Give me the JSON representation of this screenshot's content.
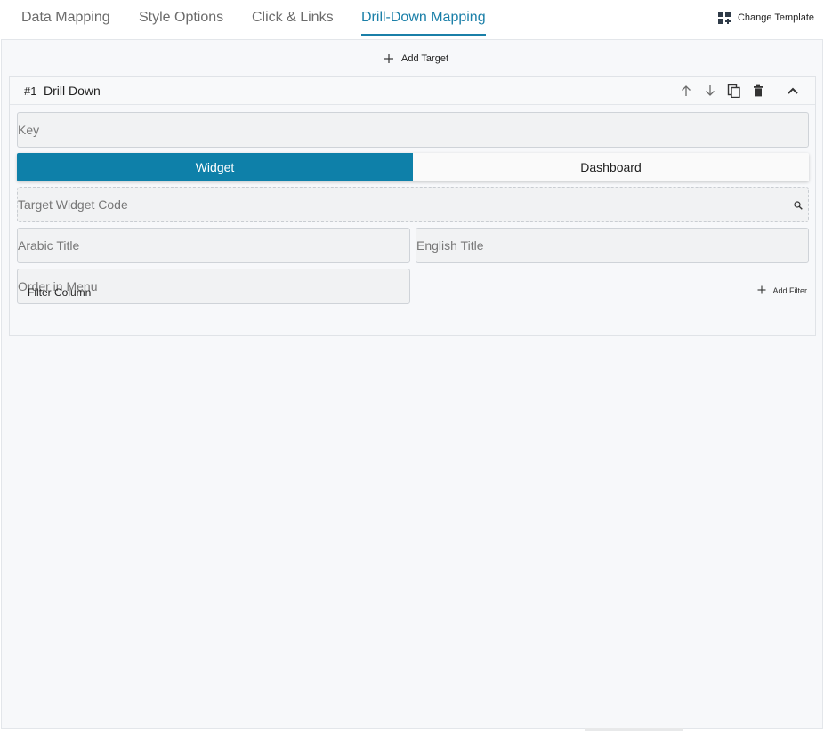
{
  "tabs": [
    {
      "label": "Data Mapping",
      "active": false
    },
    {
      "label": "Style Options",
      "active": false
    },
    {
      "label": "Click & Links",
      "active": false
    },
    {
      "label": "Drill-Down Mapping",
      "active": true
    }
  ],
  "toolbar": {
    "change_template_label": "Change Template",
    "change_template_icon": "dashboard-add-icon"
  },
  "panel": {
    "add_target_label": "Add Target",
    "add_target_icon": "plus-icon"
  },
  "card": {
    "number": "#1",
    "title": "Drill Down",
    "header_icons": [
      "arrow-up-icon",
      "arrow-down-icon",
      "copy-icon",
      "trash-icon",
      "chevron-up-icon"
    ],
    "key_placeholder": "Key",
    "toggle": {
      "options": [
        "Widget",
        "Dashboard"
      ],
      "selected": "Widget"
    },
    "target_widget_placeholder": "Target Widget Code",
    "arabic_title_placeholder": "Arabic Title",
    "english_title_placeholder": "English Title",
    "order_placeholder": "Order in Menu",
    "filter_column_label": "Filter Column",
    "add_filter_label": "Add Filter"
  },
  "colors": {
    "accent": "#1a7fa8",
    "toggle_active": "#0e80a9",
    "panel_bg": "#f7f8fa"
  }
}
